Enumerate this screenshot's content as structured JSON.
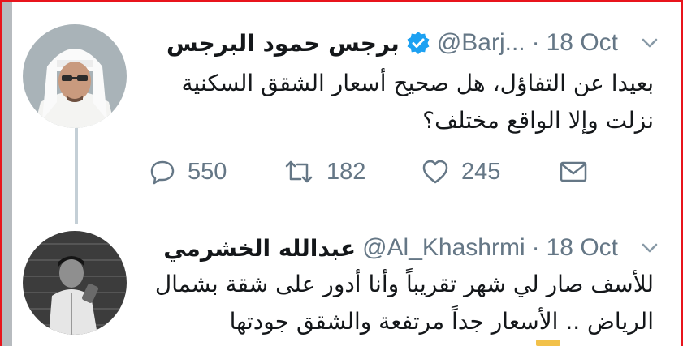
{
  "colors": {
    "frame": "#e8141c",
    "text": "#14171a",
    "muted": "#657786",
    "verified": "#1da1f2",
    "thread_line": "#c4cfd6"
  },
  "tweets": [
    {
      "name": "برجس حمود البرجس",
      "verified": true,
      "handle": "@Barj...",
      "dot": "·",
      "time": "18 Oct",
      "text": "بعيدا عن التفاؤل، هل صحيح أسعار الشقق السكنية نزلت وإلا الواقع مختلف؟",
      "actions": {
        "replies": "550",
        "retweets": "182",
        "likes": "245"
      },
      "icons": [
        "reply-icon",
        "retweet-icon",
        "like-icon",
        "mail-icon",
        "chevron-down-icon",
        "verified-badge-icon"
      ]
    },
    {
      "name": "عبدالله الخشرمي",
      "handle": "@Al_Khashrmi",
      "dot": "·",
      "time": "18 Oct",
      "text": "للأسف صار لي شهر تقريباً وأنا أدور على شقة بشمال الرياض .. الأسعار جداً مرتفعة والشقق جودتها"
    }
  ]
}
